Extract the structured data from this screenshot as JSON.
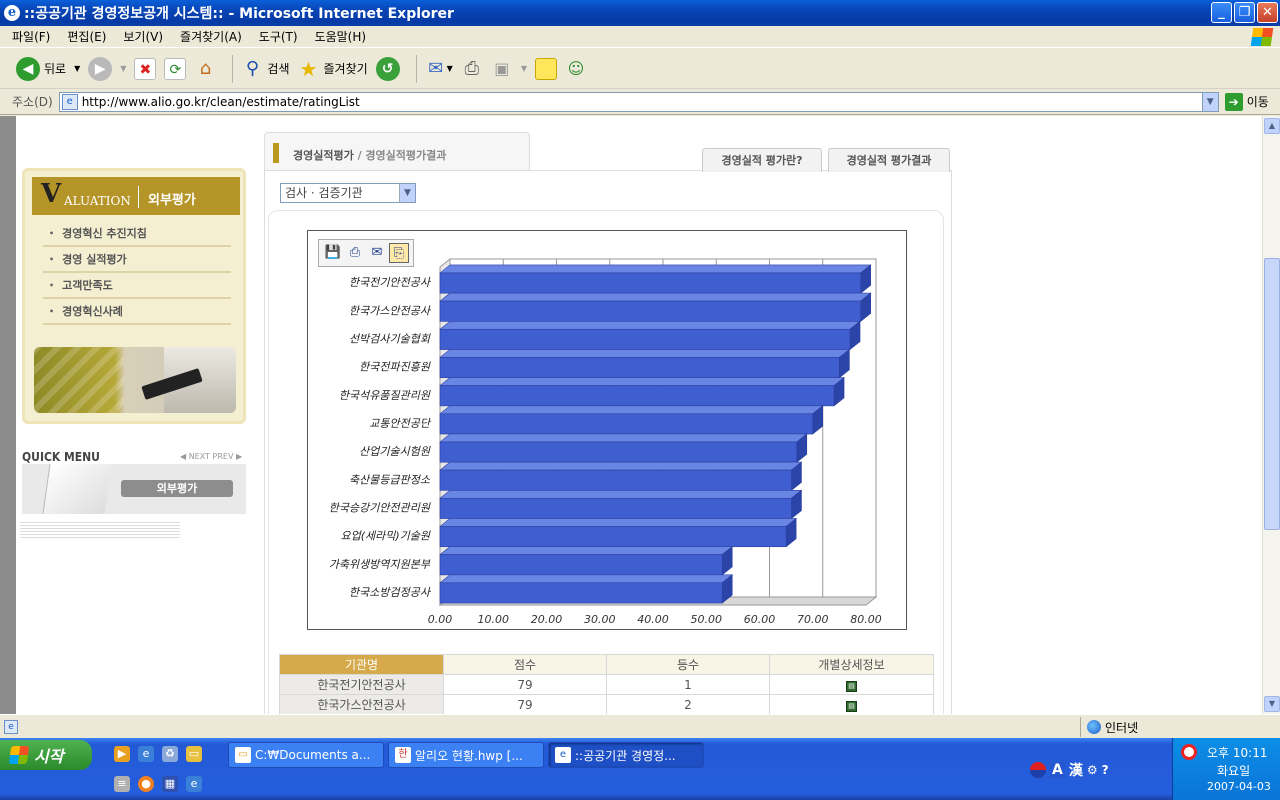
{
  "window": {
    "title": "::공공기관 경영정보공개 시스템:: - Microsoft Internet Explorer"
  },
  "menu": [
    "파일(F)",
    "편집(E)",
    "보기(V)",
    "즐겨찾기(A)",
    "도구(T)",
    "도움말(H)"
  ],
  "toolbar": {
    "back_label": "뒤로",
    "search_label": "검색",
    "favorites_label": "즐겨찾기"
  },
  "address": {
    "label": "주소(D)",
    "url": "http://www.alio.go.kr/clean/estimate/ratingList",
    "go_label": "이동"
  },
  "sidebar": {
    "header_letter": "V",
    "header_rest": "ALUATION",
    "header_kr": "외부평가",
    "items": [
      "경영혁신 추진지침",
      "경영 실적평가",
      "고객만족도",
      "경영혁신사례"
    ],
    "quick_title": "QUICK MENU",
    "quick_nav": "◀ NEXT  PREV ▶",
    "quick_button": "외부평가"
  },
  "main": {
    "tab_title": "경영실적평가",
    "tab_sub": " / 경영실적평가결과",
    "side_tabs": [
      "경영실적 평가란?",
      "경영실적 평가결과"
    ],
    "select_value": "검사 · 검증기관"
  },
  "chart_data": {
    "type": "bar",
    "orientation": "horizontal",
    "style": "3d",
    "categories": [
      "한국전기안전공사",
      "한국가스안전공사",
      "선박검사기술협회",
      "한국전파진흥원",
      "한국석유품질관리원",
      "교통안전공단",
      "산업기술시험원",
      "축산물등급판정소",
      "한국승강기안전관리원",
      "요업(세라믹)기술원",
      "가축위생방역지원본부",
      "한국소방검정공사"
    ],
    "values": [
      79,
      79,
      77,
      75,
      74,
      70,
      67,
      66,
      66,
      65,
      53,
      53
    ],
    "xlim": [
      0,
      80
    ],
    "xticks": [
      "0.00",
      "10.00",
      "20.00",
      "30.00",
      "40.00",
      "50.00",
      "60.00",
      "70.00",
      "80.00"
    ],
    "grid": true,
    "bar_color": "#3f5fd0"
  },
  "table": {
    "headers": [
      "기관명",
      "점수",
      "등수",
      "개별상세정보"
    ],
    "rows": [
      [
        "한국전기안전공사",
        "79",
        "1"
      ],
      [
        "한국가스안전공사",
        "79",
        "2"
      ]
    ]
  },
  "status": {
    "zone": "인터넷"
  },
  "taskbar": {
    "start": "시작",
    "tasks": [
      "C:₩Documents a...",
      "알리오 현황.hwp [...",
      "::공공기관 경영정..."
    ],
    "time": "오후 10:11",
    "day": "화요일",
    "date": "2007-04-03",
    "ime_a": "A",
    "ime_han": "漢"
  }
}
